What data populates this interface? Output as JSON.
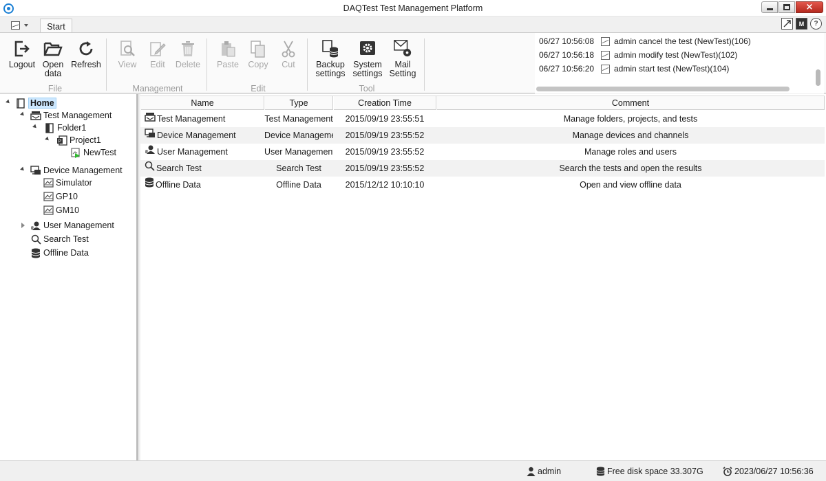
{
  "window": {
    "title": "DAQTest Test Management Platform",
    "close_glyph": "×"
  },
  "tabs": {
    "start": "Start"
  },
  "top_right": {
    "m_label": "M",
    "help_label": "?"
  },
  "ribbon": {
    "file": {
      "group_label": "File",
      "logout": "Logout",
      "open_data_1": "Open",
      "open_data_2": "data",
      "refresh": "Refresh"
    },
    "management": {
      "group_label": "Management",
      "view": "View",
      "edit": "Edit",
      "delete": "Delete"
    },
    "edit": {
      "group_label": "Edit",
      "paste": "Paste",
      "copy": "Copy",
      "cut": "Cut"
    },
    "tool": {
      "group_label": "Tool",
      "backup_1": "Backup",
      "backup_2": "settings",
      "system_1": "System",
      "system_2": "settings",
      "mail_1": "Mail",
      "mail_2": "Setting"
    }
  },
  "log": [
    {
      "time": "06/27 10:56:08",
      "message": "admin cancel the test (NewTest)(106)"
    },
    {
      "time": "06/27 10:56:18",
      "message": "admin modify test (NewTest)(102)"
    },
    {
      "time": "06/27 10:56:20",
      "message": "admin start test (NewTest)(104)"
    }
  ],
  "tree": {
    "home": "Home",
    "test_management": "Test Management",
    "folder1": "Folder1",
    "project1": "Project1",
    "newtest": "NewTest",
    "device_management": "Device Management",
    "simulator": "Simulator",
    "gp10": "GP10",
    "gm10": "GM10",
    "user_management": "User Management",
    "search_test": "Search Test",
    "offline_data": "Offline Data"
  },
  "table": {
    "columns": [
      "Name",
      "Type",
      "Creation Time",
      "Comment"
    ],
    "rows": [
      {
        "icon": "test-management-icon",
        "name": "Test Management",
        "type": "Test Management",
        "time": "2015/09/19 23:55:51",
        "comment": "Manage folders, projects, and tests"
      },
      {
        "icon": "device-management-icon",
        "name": "Device Management",
        "type": "Device Management",
        "time": "2015/09/19 23:55:52",
        "comment": "Manage devices and channels"
      },
      {
        "icon": "user-management-icon",
        "name": "User Management",
        "type": "User Management",
        "time": "2015/09/19 23:55:52",
        "comment": "Manage roles and users"
      },
      {
        "icon": "search-icon",
        "name": "Search Test",
        "type": "Search Test",
        "time": "2015/09/19 23:55:52",
        "comment": "Search the tests and open the results"
      },
      {
        "icon": "database-icon",
        "name": "Offline Data",
        "type": "Offline Data",
        "time": "2015/12/12 10:10:10",
        "comment": "Open and view offline data"
      }
    ]
  },
  "status": {
    "user": "admin",
    "disk": "Free disk space 33.307G",
    "datetime": "2023/06/27 10:56:36"
  },
  "colors": {
    "accent": "#1a7fd4",
    "selection": "#cde8ff",
    "close_button": "#c8372d",
    "disabled_text": "#a8a8a8"
  }
}
